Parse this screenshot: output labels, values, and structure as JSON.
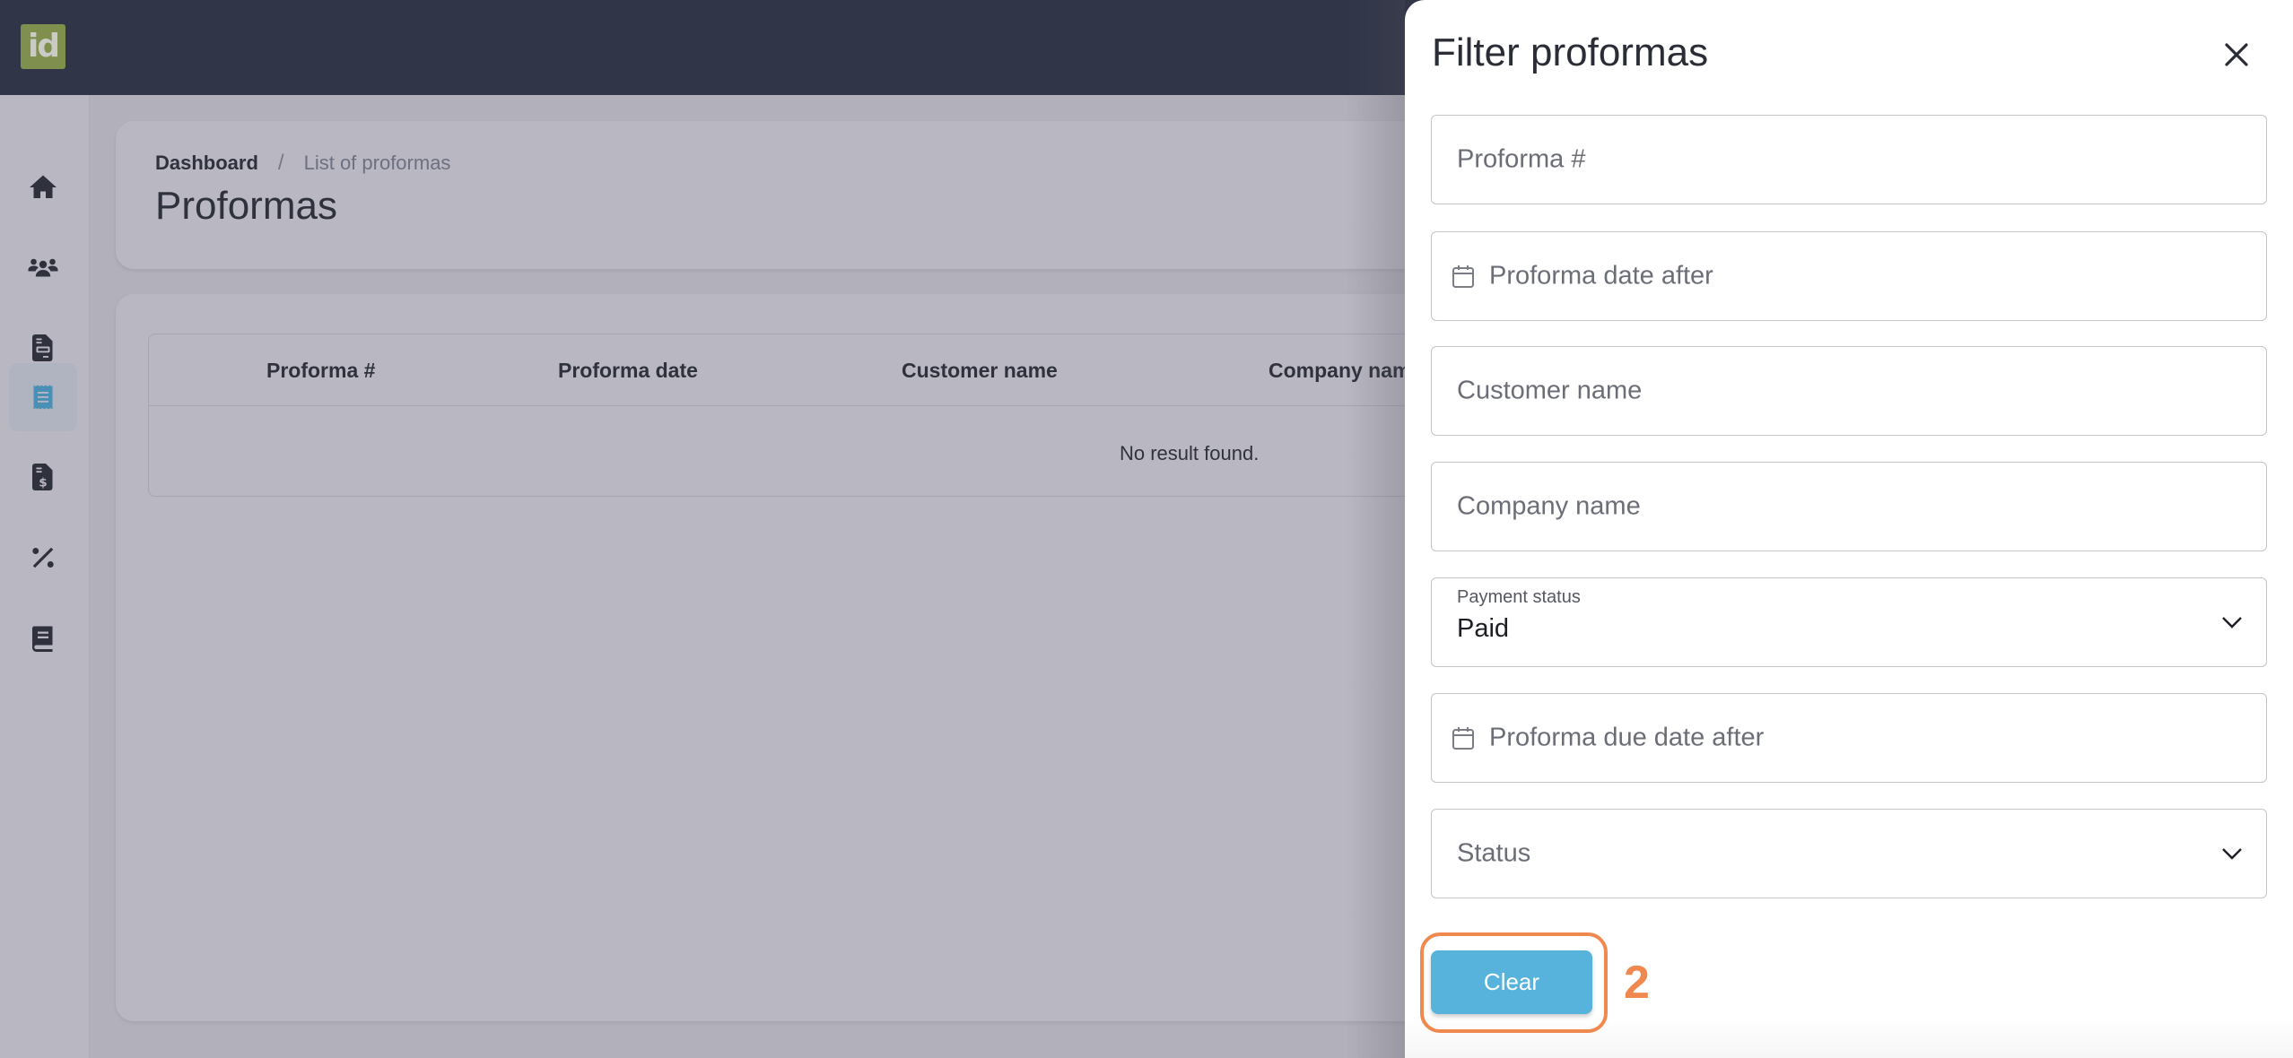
{
  "app": {
    "logo_text": "id",
    "brand_color": "#7f8f4e",
    "topbar_color": "#303548"
  },
  "sidebar": {
    "items": [
      {
        "icon": "home-icon",
        "label": "Home",
        "active": false
      },
      {
        "icon": "users-icon",
        "label": "Customers",
        "active": false
      },
      {
        "icon": "document-icon",
        "label": "Documents",
        "active": false
      },
      {
        "icon": "receipt-icon",
        "label": "Proformas",
        "active": true
      },
      {
        "icon": "invoice-dollar-icon",
        "label": "Invoices",
        "active": false
      },
      {
        "icon": "percent-icon",
        "label": "Taxes",
        "active": false
      },
      {
        "icon": "book-icon",
        "label": "Catalog",
        "active": false
      }
    ],
    "active_color": "#4a8fb5"
  },
  "header": {
    "breadcrumb": {
      "home": "Dashboard",
      "separator": "/",
      "current": "List of proformas"
    },
    "title": "Proformas"
  },
  "table": {
    "columns": [
      "Proforma #",
      "Proforma date",
      "Customer name",
      "Company nam"
    ],
    "rows": [],
    "empty_text": "No result found."
  },
  "filter_panel": {
    "title": "Filter proformas",
    "close_icon": "close-icon",
    "fields": [
      {
        "type": "text",
        "placeholder": "Proforma #",
        "value": ""
      },
      {
        "type": "date",
        "placeholder": "Proforma date after",
        "value": ""
      },
      {
        "type": "text",
        "placeholder": "Customer name",
        "value": ""
      },
      {
        "type": "text",
        "placeholder": "Company name",
        "value": ""
      },
      {
        "type": "select",
        "label": "Payment status",
        "value": "Paid"
      },
      {
        "type": "date",
        "placeholder": "Proforma due date after",
        "value": ""
      },
      {
        "type": "select",
        "placeholder": "Status",
        "value": ""
      }
    ],
    "clear_label": "Clear",
    "clear_color": "#57b3dc"
  },
  "annotation": {
    "number": "2",
    "color": "#f0894f"
  }
}
